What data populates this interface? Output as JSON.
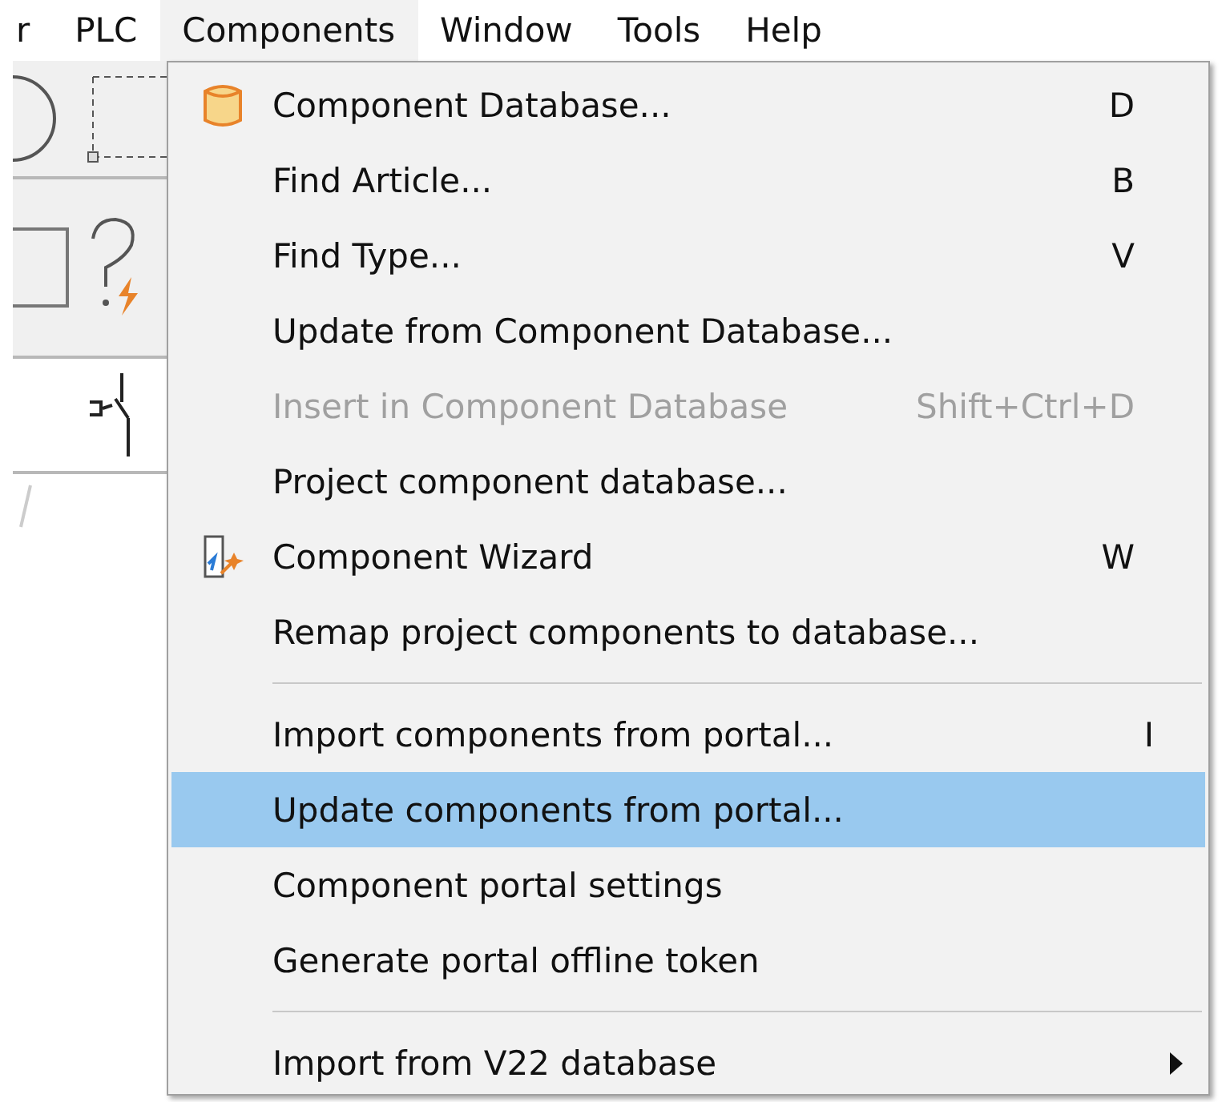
{
  "menubar": [
    {
      "label": "r",
      "selected": false
    },
    {
      "label": "PLC",
      "selected": false
    },
    {
      "label": "Components",
      "selected": true
    },
    {
      "label": "Window",
      "selected": false
    },
    {
      "label": "Tools",
      "selected": false
    },
    {
      "label": "Help",
      "selected": false
    }
  ],
  "menu": [
    {
      "kind": "item",
      "label": "Component Database...",
      "shortcut": "D",
      "disabled": false,
      "selected": false
    },
    {
      "kind": "item",
      "label": "Find Article...",
      "shortcut": "B",
      "disabled": false,
      "selected": false
    },
    {
      "kind": "item",
      "label": "Find Type...",
      "shortcut": "V",
      "disabled": false,
      "selected": false
    },
    {
      "kind": "item",
      "label": "Update from Component Database...",
      "disabled": false,
      "selected": false
    },
    {
      "kind": "item",
      "label": "Insert in Component Database",
      "shortcut": "Shift+Ctrl+D",
      "disabled": true,
      "selected": false
    },
    {
      "kind": "item",
      "label": "Project component database...",
      "disabled": false,
      "selected": false
    },
    {
      "kind": "item",
      "label": "Component Wizard",
      "shortcut": "W",
      "disabled": false,
      "selected": false
    },
    {
      "kind": "item",
      "label": "Remap project components to database...",
      "disabled": false,
      "selected": false
    },
    {
      "kind": "separator"
    },
    {
      "kind": "item",
      "label": "Import components from portal...",
      "shortcut": "I",
      "disabled": false,
      "selected": false
    },
    {
      "kind": "item",
      "label": "Update components from portal...",
      "disabled": false,
      "selected": true
    },
    {
      "kind": "item",
      "label": "Component portal settings",
      "disabled": false,
      "selected": false
    },
    {
      "kind": "item",
      "label": "Generate portal offline token",
      "disabled": false,
      "selected": false
    },
    {
      "kind": "separator"
    },
    {
      "kind": "item",
      "label": "Import from V22 database",
      "disabled": false,
      "selected": false,
      "submenu": true
    }
  ]
}
